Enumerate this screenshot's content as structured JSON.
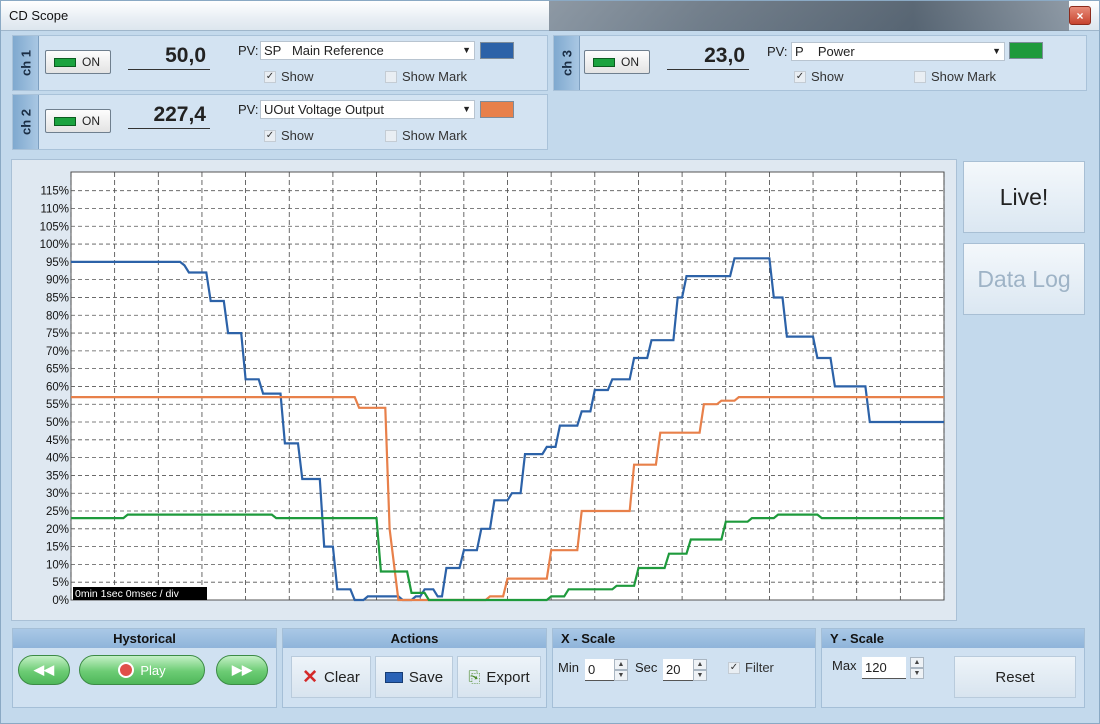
{
  "window": {
    "title": "CD Scope",
    "close_glyph": "×"
  },
  "channels": [
    {
      "tab": "ch 1",
      "on_label": "ON",
      "value": "50,0",
      "pv_label": "PV:",
      "pv_selected": "SP   Main Reference",
      "color": "#2c62a8",
      "show_label": "Show",
      "show_checked": "✓",
      "showmark_label": "Show Mark"
    },
    {
      "tab": "ch 2",
      "on_label": "ON",
      "value": "227,4",
      "pv_label": "PV:",
      "pv_selected": "UOut Voltage Output",
      "color": "#e8804a",
      "show_label": "Show",
      "show_checked": "✓",
      "showmark_label": "Show Mark"
    },
    {
      "tab": "ch 3",
      "on_label": "ON",
      "value": "23,0",
      "pv_label": "PV:",
      "pv_selected": "P    Power",
      "color": "#1e9a3c",
      "show_label": "Show",
      "show_checked": "✓",
      "showmark_label": "Show Mark"
    }
  ],
  "side": {
    "live_label": "Live!",
    "datalog_label": "Data Log"
  },
  "historical": {
    "title": "Hystorical",
    "play_label": "Play",
    "rewind_glyph": "◀◀",
    "forward_glyph": "▶▶"
  },
  "actions": {
    "title": "Actions",
    "clear_label": "Clear",
    "save_label": "Save",
    "export_label": "Export"
  },
  "xscale": {
    "title": "X - Scale",
    "min_label": "Min",
    "min_value": "0",
    "sec_label": "Sec",
    "sec_value": "20",
    "filter_label": "Filter",
    "filter_checked": "✓"
  },
  "yscale": {
    "title": "Y - Scale",
    "max_label": "Max",
    "max_value": "120",
    "reset_label": "Reset"
  },
  "chart_data": {
    "type": "line",
    "time_label": "0min 1sec 0msec / div",
    "y_ticks": [
      "0%",
      "5%",
      "10%",
      "15%",
      "20%",
      "25%",
      "30%",
      "35%",
      "40%",
      "45%",
      "50%",
      "55%",
      "60%",
      "65%",
      "70%",
      "75%",
      "80%",
      "85%",
      "90%",
      "95%",
      "100%",
      "105%",
      "110%",
      "115%"
    ],
    "ylim": [
      0,
      118
    ],
    "xlim": [
      0,
      20
    ],
    "grid": true,
    "series": [
      {
        "color": "#2c62a8",
        "x": [
          0,
          2.5,
          2.6,
          2.7,
          3.1,
          3.2,
          3.5,
          3.6,
          3.9,
          4.0,
          4.3,
          4.4,
          4.8,
          4.9,
          5.2,
          5.3,
          5.7,
          5.8,
          6.0,
          6.1,
          6.4,
          6.5,
          6.7,
          6.8,
          7.5,
          7.6,
          7.8,
          7.9,
          8.0,
          8.1,
          8.3,
          8.4,
          8.5,
          8.6,
          8.9,
          9.0,
          9.3,
          9.4,
          9.6,
          9.7,
          10.0,
          10.1,
          10.3,
          10.4,
          10.8,
          10.9,
          11.1,
          11.2,
          11.6,
          11.7,
          11.9,
          12.0,
          12.3,
          12.4,
          12.8,
          12.9,
          13.2,
          13.3,
          13.8,
          13.9,
          14.0,
          14.1,
          15.1,
          15.2,
          15.5,
          15.6,
          16.0,
          16.1,
          16.3,
          16.4,
          17.0,
          17.1,
          17.4,
          17.5,
          18.2,
          18.3,
          20.0
        ],
        "values": [
          95,
          95,
          94,
          92,
          92,
          84,
          84,
          75,
          75,
          62,
          62,
          58,
          58,
          44,
          44,
          34,
          34,
          15,
          15,
          3,
          3,
          0,
          0,
          1,
          1,
          0,
          0,
          1,
          1,
          3,
          3,
          1,
          1,
          9,
          9,
          14,
          14,
          20,
          20,
          28,
          28,
          30,
          30,
          41,
          41,
          43,
          43,
          49,
          49,
          53,
          53,
          59,
          59,
          62,
          62,
          68,
          68,
          73,
          73,
          85,
          85,
          91,
          91,
          96,
          96,
          96,
          96,
          85,
          85,
          74,
          74,
          68,
          68,
          60,
          60,
          50,
          50
        ]
      },
      {
        "color": "#e8804a",
        "x": [
          0,
          6.5,
          6.6,
          7.2,
          7.3,
          7.5,
          7.6,
          9.5,
          9.6,
          9.9,
          10.0,
          10.9,
          11.0,
          11.6,
          11.7,
          12.8,
          12.9,
          13.4,
          13.5,
          14.4,
          14.5,
          14.8,
          14.9,
          15.2,
          15.3,
          20.0
        ],
        "values": [
          57,
          57,
          54,
          54,
          20,
          0,
          0,
          0,
          1,
          1,
          6,
          6,
          14,
          14,
          25,
          25,
          38,
          38,
          47,
          47,
          55,
          55,
          56,
          56,
          57,
          57
        ]
      },
      {
        "color": "#1e9a3c",
        "x": [
          0,
          1.2,
          1.3,
          4.6,
          4.7,
          7.0,
          7.1,
          7.7,
          7.8,
          8.1,
          8.2,
          10.9,
          11.0,
          11.3,
          11.4,
          12.4,
          12.5,
          12.9,
          13.0,
          13.6,
          13.7,
          14.1,
          14.2,
          14.9,
          15.0,
          15.5,
          15.6,
          16.1,
          16.2,
          17.1,
          17.2,
          20.0
        ],
        "values": [
          23,
          23,
          24,
          24,
          23,
          23,
          8,
          8,
          2,
          2,
          0,
          0,
          1,
          1,
          3,
          3,
          4,
          4,
          9,
          9,
          13,
          13,
          17,
          17,
          22,
          22,
          23,
          23,
          24,
          24,
          23,
          23
        ]
      }
    ]
  }
}
